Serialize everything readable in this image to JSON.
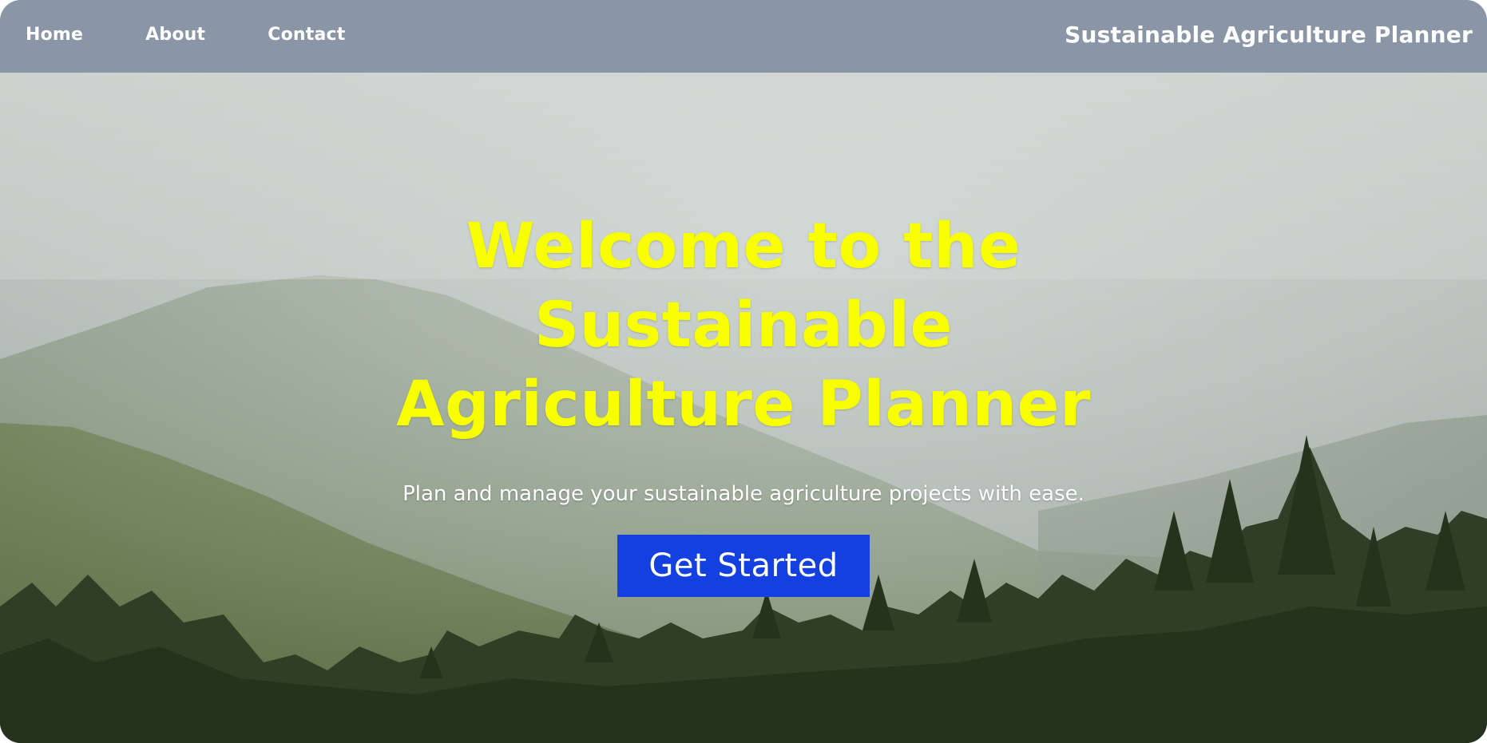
{
  "nav": {
    "links": [
      {
        "label": "Home"
      },
      {
        "label": "About"
      },
      {
        "label": "Contact"
      }
    ],
    "brand": "Sustainable Agriculture Planner"
  },
  "hero": {
    "title": "Welcome to the Sustainable Agriculture Planner",
    "subtitle": "Plan and manage your sustainable agriculture projects with ease.",
    "cta_label": "Get Started",
    "background": "misty-mountain-forest-photo"
  },
  "colors": {
    "navbar": "#8a95a5",
    "title": "#f7ff00",
    "cta": "#1340df"
  }
}
